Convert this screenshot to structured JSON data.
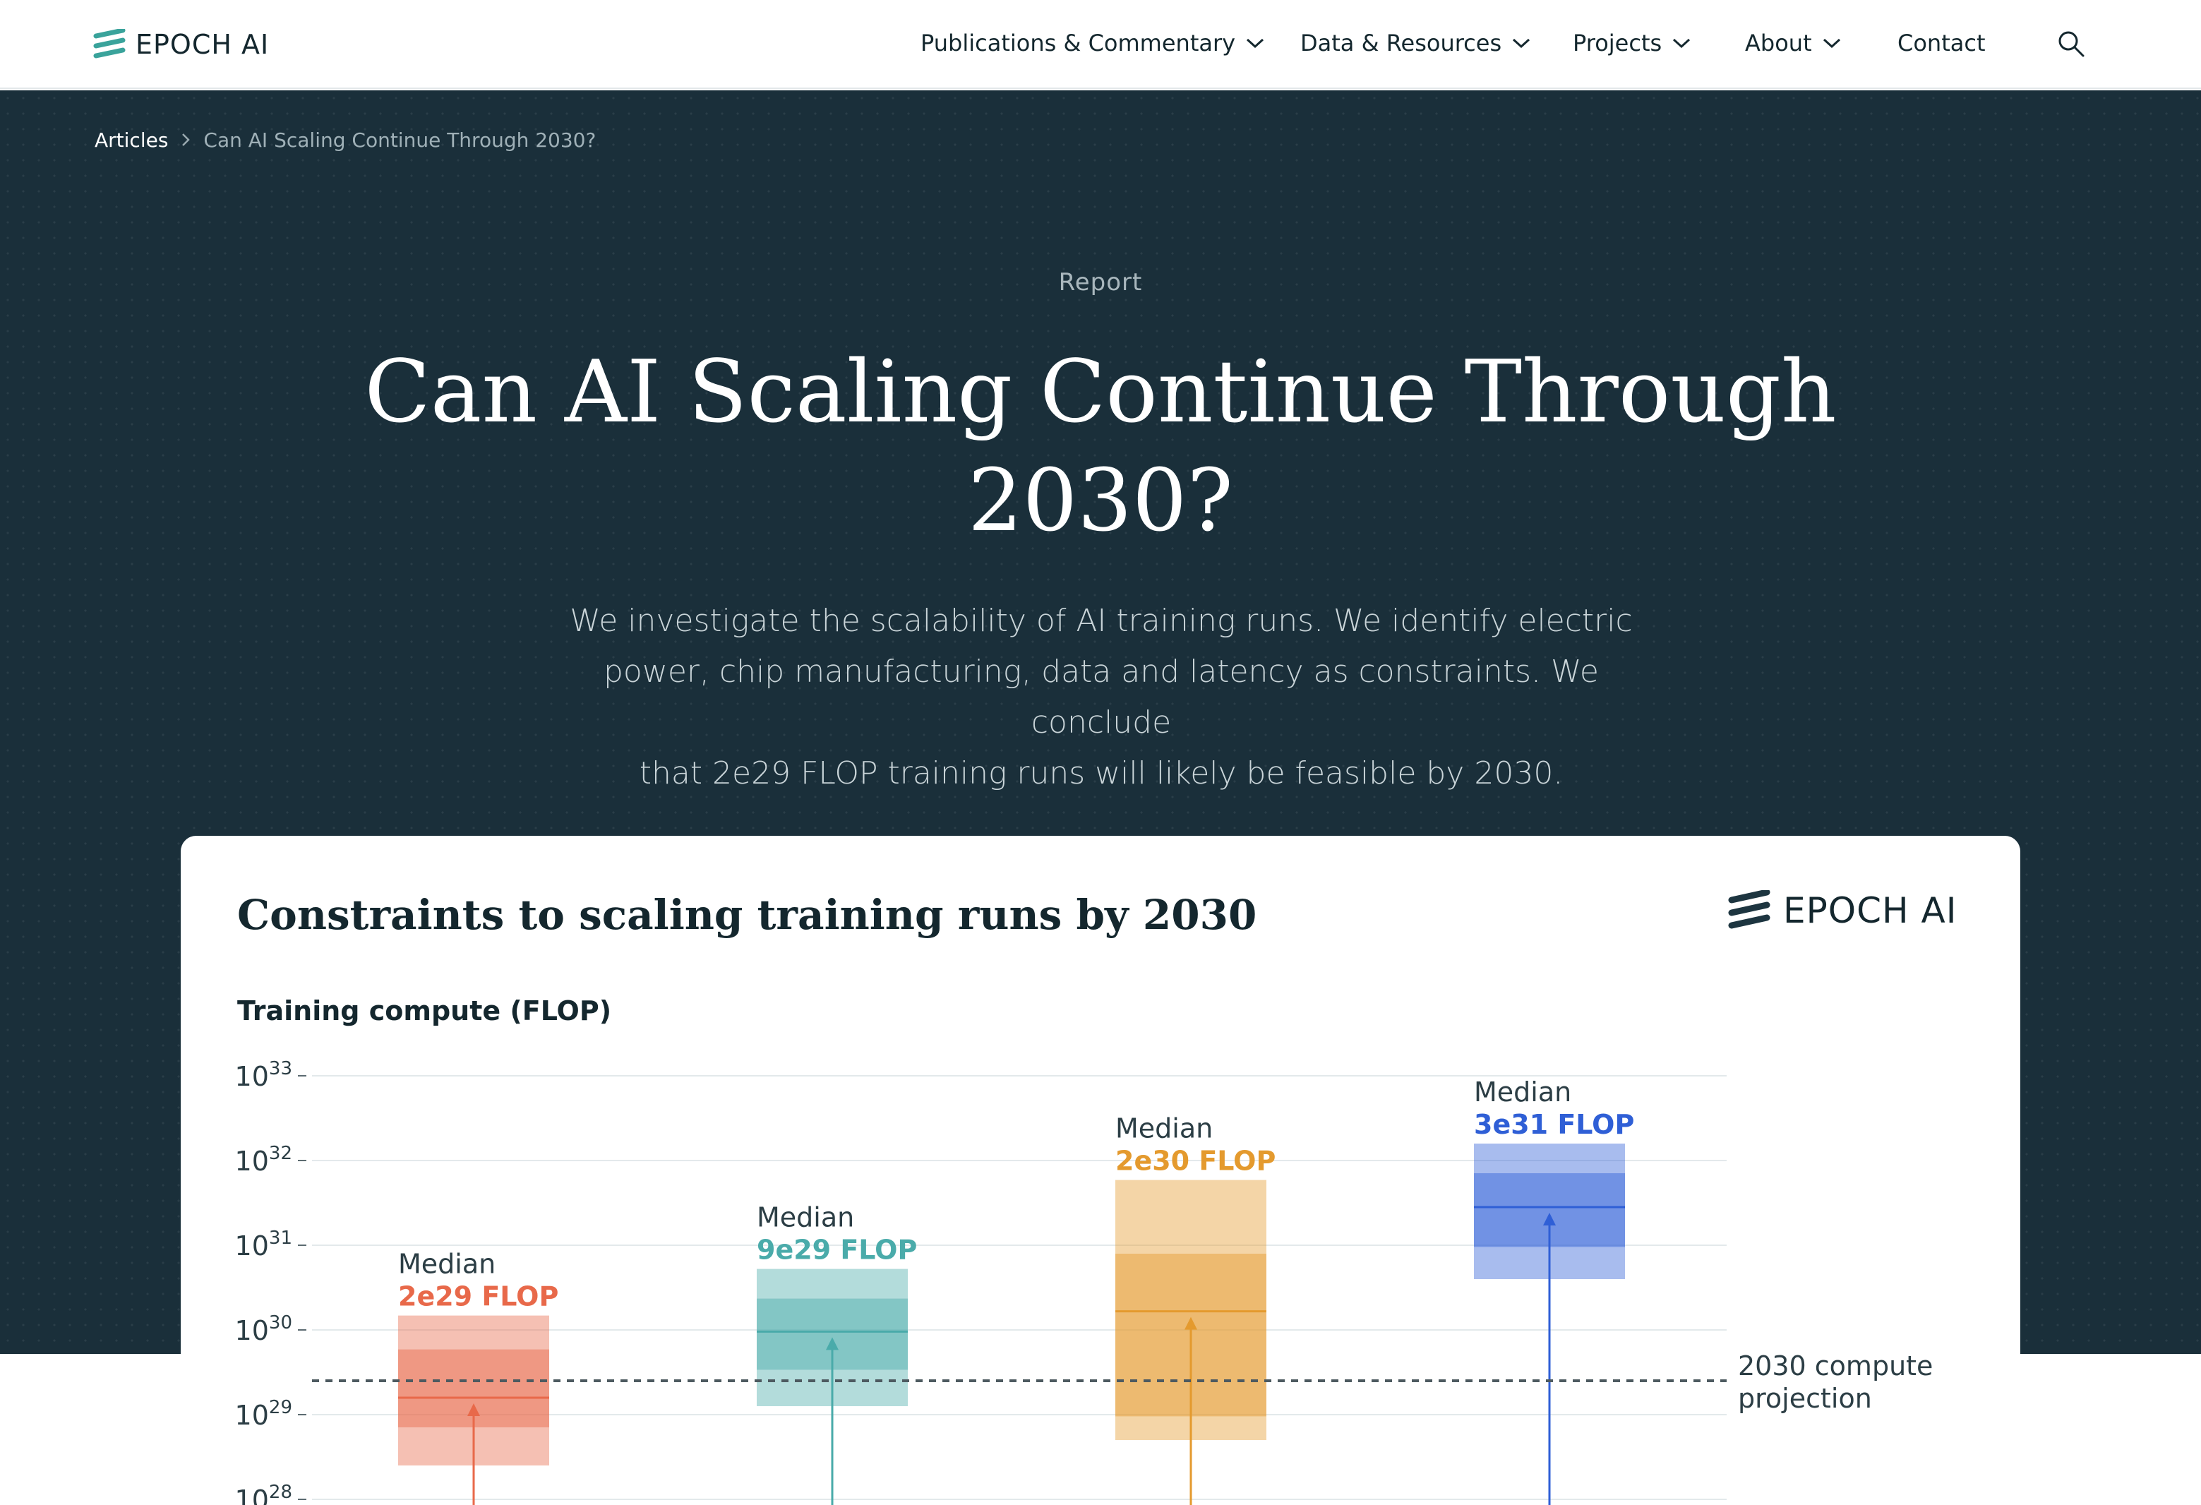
{
  "brand": {
    "name": "EPOCH AI"
  },
  "nav": {
    "items": [
      {
        "label": "Publications & Commentary",
        "has_dropdown": true
      },
      {
        "label": "Data & Resources",
        "has_dropdown": true
      },
      {
        "label": "Projects",
        "has_dropdown": true
      },
      {
        "label": "About",
        "has_dropdown": true
      },
      {
        "label": "Contact",
        "has_dropdown": false
      }
    ],
    "search_icon": "search-icon"
  },
  "breadcrumb": {
    "parent": "Articles",
    "current": "Can AI Scaling Continue Through 2030?"
  },
  "hero": {
    "tag": "Report",
    "title_line1": "Can AI Scaling Continue Through",
    "title_line2": "2030?",
    "subtitle_line1": "We investigate the scalability of AI training runs. We identify electric",
    "subtitle_line2": "power, chip manufacturing, data and latency as constraints. We conclude",
    "subtitle_line3": "that 2e29 FLOP training runs will likely be feasible by 2030."
  },
  "colors": {
    "nav_bg": "#ffffff",
    "hero_bg": "#1a2f3a",
    "brand_teal": "#3aa39b",
    "orange_red": "#e8694a",
    "teal": "#4aabaa",
    "amber": "#e49a2e",
    "blue": "#2f5fd6"
  },
  "chart_data": {
    "type": "box",
    "title": "Constraints to scaling training runs by 2030",
    "ylabel": "Training compute (FLOP)",
    "yscale": "log",
    "ylim_exponent": [
      28,
      33
    ],
    "yticks": [
      {
        "base": "10",
        "exp": "33",
        "value": 33
      },
      {
        "base": "10",
        "exp": "32",
        "value": 32
      },
      {
        "base": "10",
        "exp": "31",
        "value": 31
      },
      {
        "base": "10",
        "exp": "30",
        "value": 30
      },
      {
        "base": "10",
        "exp": "29",
        "value": 29
      },
      {
        "base": "10",
        "exp": "28",
        "value": 28
      }
    ],
    "series": [
      {
        "median_word": "Median",
        "median_label": "2e29 FLOP",
        "median_log": 29.2,
        "outer_low": 28.4,
        "outer_high": 30.17,
        "inner_low": 28.85,
        "inner_high": 29.77,
        "color": "#e8694a"
      },
      {
        "median_word": "Median",
        "median_label": "9e29 FLOP",
        "median_log": 29.98,
        "outer_low": 29.1,
        "outer_high": 30.72,
        "inner_low": 29.53,
        "inner_high": 30.37,
        "color": "#4aabaa"
      },
      {
        "median_word": "Median",
        "median_label": "2e30 FLOP",
        "median_log": 30.22,
        "outer_low": 28.7,
        "outer_high": 31.77,
        "inner_low": 28.98,
        "inner_high": 30.9,
        "color": "#e49a2e"
      },
      {
        "median_word": "Median",
        "median_label": "3e31 FLOP",
        "median_log": 31.45,
        "outer_low": 30.6,
        "outer_high": 32.2,
        "inner_low": 30.98,
        "inner_high": 31.85,
        "color": "#2f5fd6"
      }
    ],
    "reference_line": {
      "log_value": 29.4,
      "label_line1": "2030 compute",
      "label_line2": "projection"
    }
  }
}
